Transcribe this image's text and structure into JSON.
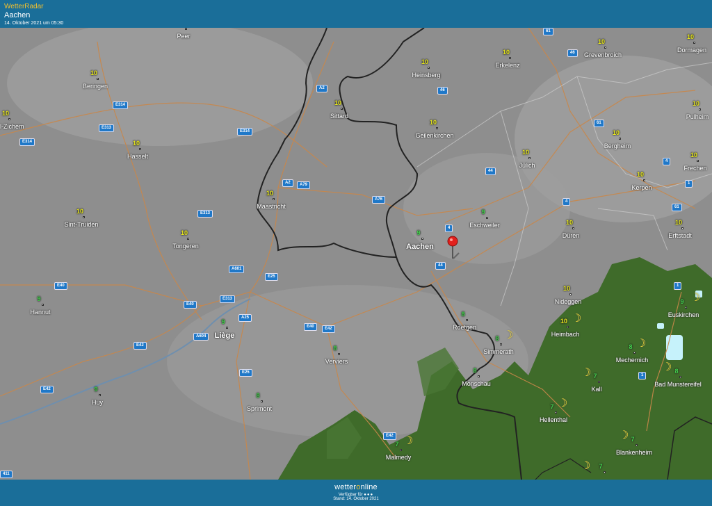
{
  "header": {
    "brand": "WetterRadar",
    "city": "Aachen",
    "date": "14. Oktober 2021 um 05:30"
  },
  "footer": {
    "logo_pre": "wetter",
    "logo_o": "o",
    "logo_post": "nline",
    "available": "Verfügbar für",
    "dots": "●●●",
    "stand": "Stand: 14. Oktober 2021"
  },
  "colors": {
    "header_bg": "#1a6e99",
    "accent": "#f2c12e",
    "land": "#8c8c8c",
    "forest": "#3e6a2a",
    "temp_10": "#e8e81a",
    "temp_low": "#41d34a"
  },
  "cities": [
    {
      "id": "peer",
      "name": "Peer",
      "temp": ""
    },
    {
      "id": "beringen",
      "name": "Beringen",
      "temp": "10"
    },
    {
      "id": "heusden",
      "name": "uvel-Zichem",
      "temp": "10"
    },
    {
      "id": "hasselt",
      "name": "Hasselt",
      "temp": "10"
    },
    {
      "id": "sint-truiden",
      "name": "Sint-Truiden",
      "temp": "10"
    },
    {
      "id": "tongeren",
      "name": "Tongeren",
      "temp": "10"
    },
    {
      "id": "hannut",
      "name": "Hannut",
      "temp": "9"
    },
    {
      "id": "huy",
      "name": "Huy",
      "temp": "9"
    },
    {
      "id": "liege",
      "name": "Liège",
      "temp": "9"
    },
    {
      "id": "maastricht",
      "name": "Maastricht",
      "temp": "10"
    },
    {
      "id": "sittard",
      "name": "Sittard",
      "temp": "10"
    },
    {
      "id": "heinsberg",
      "name": "Heinsberg",
      "temp": "10"
    },
    {
      "id": "geilenkirchen",
      "name": "Geilenkirchen",
      "temp": "10"
    },
    {
      "id": "erkelenz",
      "name": "Erkelenz",
      "temp": "10"
    },
    {
      "id": "grevenbroich",
      "name": "Grevenbroich",
      "temp": "10"
    },
    {
      "id": "dormagen",
      "name": "Dormagen",
      "temp": "10"
    },
    {
      "id": "pulheim",
      "name": "Pulheim",
      "temp": "10"
    },
    {
      "id": "frechen",
      "name": "Frechen",
      "temp": "10"
    },
    {
      "id": "bergheim",
      "name": "Bergheim",
      "temp": "10"
    },
    {
      "id": "kerpen",
      "name": "Kerpen",
      "temp": "10"
    },
    {
      "id": "erftstadt",
      "name": "Erftstadt",
      "temp": "10"
    },
    {
      "id": "julich",
      "name": "Jülich",
      "temp": "10"
    },
    {
      "id": "duren",
      "name": "Düren",
      "temp": "10"
    },
    {
      "id": "eschweiler",
      "name": "Eschweiler",
      "temp": "9"
    },
    {
      "id": "aachen",
      "name": "Aachen",
      "temp": "9"
    },
    {
      "id": "nideggen",
      "name": "Nideggen",
      "temp": "10"
    },
    {
      "id": "heimbach",
      "name": "Heimbach",
      "temp": "10"
    },
    {
      "id": "euskirchen",
      "name": "Euskirchen",
      "temp": "9"
    },
    {
      "id": "mechernich",
      "name": "Mechernich",
      "temp": "8"
    },
    {
      "id": "bad-muenstereifel",
      "name": "Bad Munstereifel",
      "temp": "8"
    },
    {
      "id": "kall",
      "name": "Kall",
      "temp": "7"
    },
    {
      "id": "hellenthal",
      "name": "Hellenthal",
      "temp": "7"
    },
    {
      "id": "blankenheim",
      "name": "Blankenheim",
      "temp": "7"
    },
    {
      "id": "roetgen",
      "name": "Roetgen",
      "temp": "8"
    },
    {
      "id": "simmerath",
      "name": "Simmerath",
      "temp": "8"
    },
    {
      "id": "monschau",
      "name": "Monschau",
      "temp": "8"
    },
    {
      "id": "verviers",
      "name": "Verviers",
      "temp": "8"
    },
    {
      "id": "sprimont",
      "name": "Sprimont",
      "temp": "8"
    },
    {
      "id": "malmedy",
      "name": "Malmedy",
      "temp": "7"
    },
    {
      "id": "bottom-right",
      "name": "",
      "temp": "7"
    }
  ],
  "roads": [
    "61",
    "46",
    "46",
    "A2",
    "A2",
    "A79",
    "A76",
    "E314",
    "E313",
    "E314",
    "E314",
    "4",
    "44",
    "61",
    "4",
    "1",
    "61",
    "4",
    "44",
    "1",
    "E313",
    "A601",
    "E25",
    "E40",
    "E313",
    "A25",
    "E40",
    "E42",
    "E40",
    "E42",
    "A604",
    "E25",
    "E42",
    "E42",
    "1",
    "411"
  ]
}
